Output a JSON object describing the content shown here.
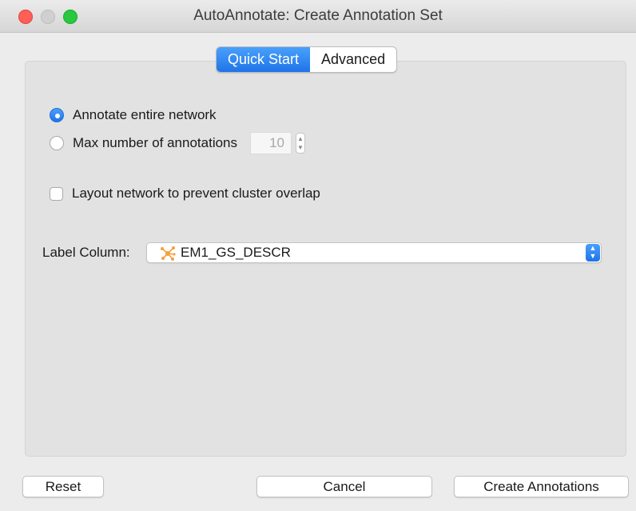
{
  "window": {
    "title": "AutoAnnotate: Create Annotation Set"
  },
  "tabs": [
    {
      "label": "Quick Start",
      "active": true
    },
    {
      "label": "Advanced",
      "active": false
    }
  ],
  "options": {
    "annotate_entire_network": {
      "label": "Annotate entire network",
      "selected": true
    },
    "max_annotations": {
      "label": "Max number of annotations",
      "selected": false,
      "value": "10"
    },
    "layout_network": {
      "label": "Layout network to prevent cluster overlap",
      "checked": false
    }
  },
  "label_column": {
    "label": "Label Column:",
    "value": "EM1_GS_DESCR",
    "icon": "network-node-icon"
  },
  "buttons": {
    "reset": "Reset",
    "cancel": "Cancel",
    "create": "Create Annotations"
  },
  "colors": {
    "accent": "#1f74e8",
    "close": "#ff5f57",
    "maximize": "#28c840",
    "node_icon": "#f5a040"
  }
}
